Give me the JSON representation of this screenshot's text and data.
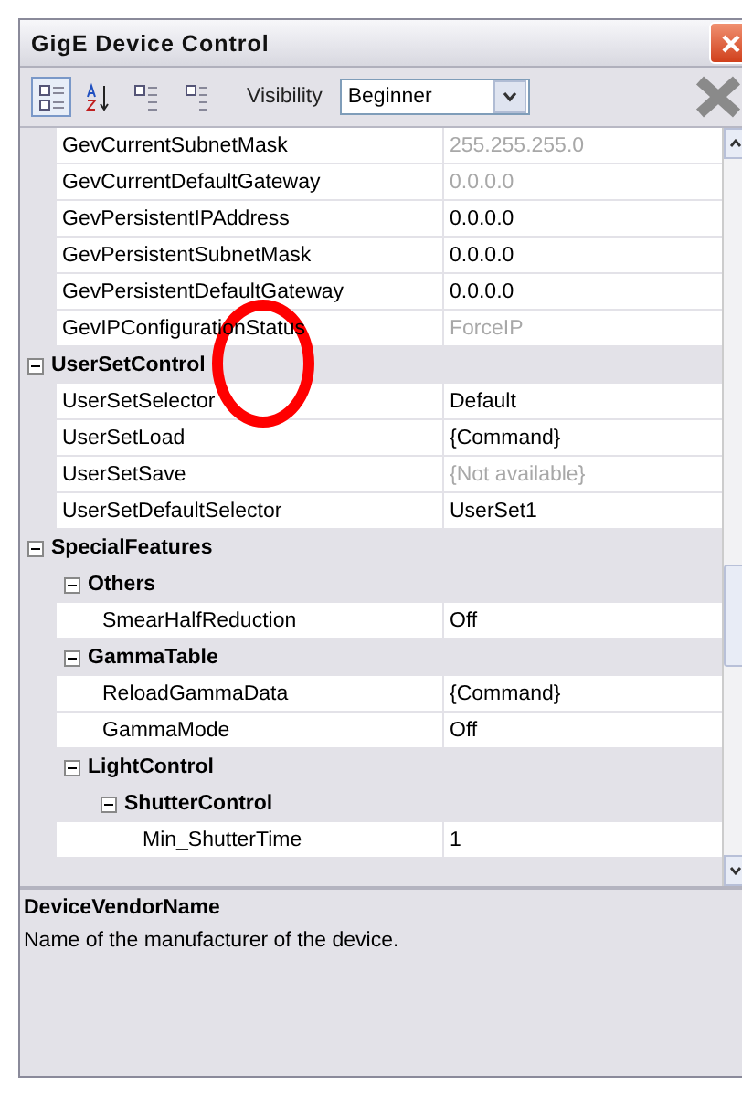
{
  "window": {
    "title": "GigE Device Control"
  },
  "toolbar": {
    "buttons": [
      {
        "kind": "categorized",
        "selected": true
      },
      {
        "kind": "alphabetical",
        "selected": false
      },
      {
        "kind": "expand",
        "selected": false
      },
      {
        "kind": "collapse",
        "selected": false
      }
    ],
    "visibility_label": "Visibility",
    "visibility_value": "Beginner"
  },
  "grid": {
    "rows": [
      {
        "kind": "property",
        "name": "GevCurrentSubnetMask",
        "value": "255.255.255.0",
        "readonly": true
      },
      {
        "kind": "property",
        "name": "GevCurrentDefaultGateway",
        "value": "0.0.0.0",
        "readonly": true
      },
      {
        "kind": "property",
        "name": "GevPersistentIPAddress",
        "value": "0.0.0.0",
        "readonly": false
      },
      {
        "kind": "property",
        "name": "GevPersistentSubnetMask",
        "value": "0.0.0.0",
        "readonly": false
      },
      {
        "kind": "property",
        "name": "GevPersistentDefaultGateway",
        "value": "0.0.0.0",
        "readonly": false
      },
      {
        "kind": "property",
        "name": "GevIPConfigurationStatus",
        "value": "ForceIP",
        "readonly": true
      },
      {
        "kind": "category",
        "name": "UserSetControl",
        "expanded": true,
        "children": [
          {
            "kind": "property",
            "name": "UserSetSelector",
            "value": "Default",
            "readonly": false
          },
          {
            "kind": "property",
            "name": "UserSetLoad",
            "value": "{Command}",
            "readonly": false
          },
          {
            "kind": "property",
            "name": "UserSetSave",
            "value": "{Not available}",
            "readonly": true
          },
          {
            "kind": "property",
            "name": "UserSetDefaultSelector",
            "value": "UserSet1",
            "readonly": false
          }
        ]
      },
      {
        "kind": "category",
        "name": "SpecialFeatures",
        "expanded": true,
        "children": [
          {
            "kind": "category",
            "name": "Others",
            "expanded": true,
            "children": [
              {
                "kind": "property",
                "name": "SmearHalfReduction",
                "value": "Off",
                "readonly": false
              }
            ]
          },
          {
            "kind": "category",
            "name": "GammaTable",
            "expanded": true,
            "children": [
              {
                "kind": "property",
                "name": "ReloadGammaData",
                "value": "{Command}",
                "readonly": false
              },
              {
                "kind": "property",
                "name": "GammaMode",
                "value": "Off",
                "readonly": false
              }
            ]
          },
          {
            "kind": "category",
            "name": "LightControl",
            "expanded": true,
            "children": [
              {
                "kind": "category",
                "name": "ShutterControl",
                "expanded": true,
                "children": [
                  {
                    "kind": "property",
                    "name": "Min_ShutterTime",
                    "value": "1",
                    "readonly": false
                  }
                ]
              }
            ]
          }
        ]
      }
    ]
  },
  "description": {
    "title": "DeviceVendorName",
    "text": "Name of the manufacturer of the device."
  }
}
